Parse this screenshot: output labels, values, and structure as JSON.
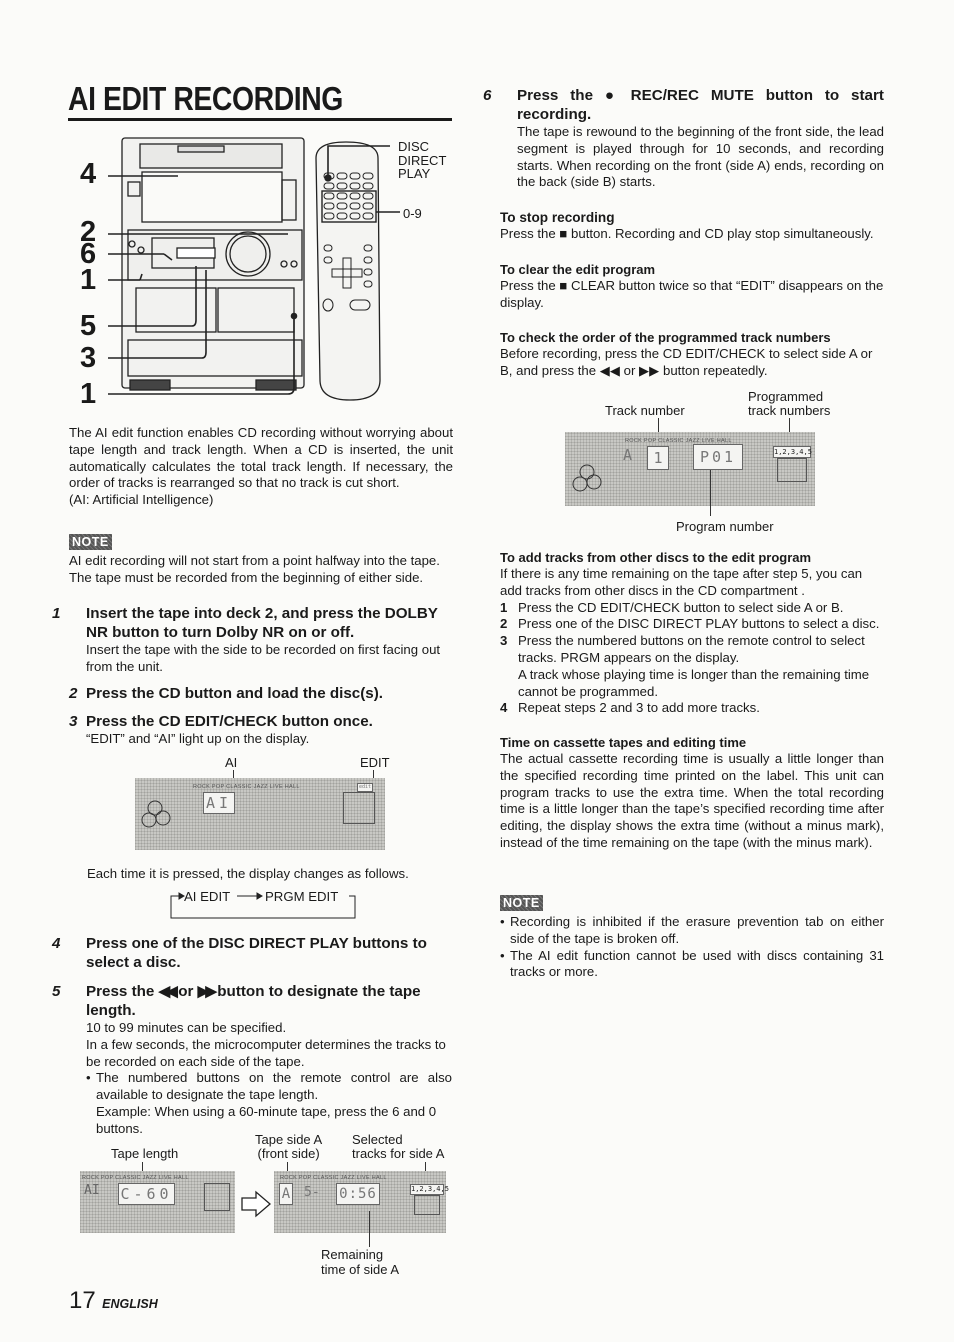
{
  "page": {
    "title": "AI EDIT RECORDING",
    "page_number": "17",
    "language": "ENGLISH"
  },
  "illustration": {
    "callouts_left": [
      "4",
      "2",
      "6",
      "1",
      "5",
      "3",
      "1"
    ],
    "remote_labels": {
      "disc_direct_play": [
        "DISC",
        "DIRECT",
        "PLAY"
      ],
      "number_keys": "0-9"
    }
  },
  "intro": {
    "text": "The AI edit function enables CD recording without worrying about tape length and track length.  When a CD is inserted, the unit automatically calculates the total track length.  If necessary, the order of tracks is rearranged so that no track is cut short.",
    "abbr": "(AI: Artificial Intelligence)"
  },
  "note1": {
    "badge": "NOTE",
    "lines": [
      "AI edit recording will not start from a point halfway into the tape.",
      "The tape must be recorded from the beginning of either side."
    ]
  },
  "steps": [
    {
      "num": "1",
      "heading": "Insert the tape into deck 2, and press the DOLBY NR button to turn Dolby NR on or off.",
      "body": "Insert the tape with the side to be recorded on first facing out from the unit."
    },
    {
      "num": "2",
      "heading": "Press the CD button and load the disc(s).",
      "body": ""
    },
    {
      "num": "3",
      "heading": "Press the CD EDIT/CHECK button once.",
      "body": "“EDIT” and “AI” light up on the display."
    },
    {
      "num": "4",
      "heading": "Press one of the DISC DIRECT PLAY buttons to select a disc.",
      "body": ""
    },
    {
      "num": "5",
      "heading_pre": "Press the",
      "heading_rew": "◀◀",
      "heading_or": "or",
      "heading_ff": "▶▶",
      "heading_post": "button to designate the tape length.",
      "body_lines": [
        "10 to 99 minutes can be specified.",
        "In a few seconds, the microcomputer determines the tracks to be recorded on each side of the tape."
      ],
      "bullet": "The numbered buttons on the remote control are also available to designate the tape length.",
      "example": "Example:  When using a 60-minute tape, press the 6 and 0 buttons."
    },
    {
      "num": "6",
      "heading_pre": "Press the",
      "heading_icon": "●",
      "heading_post": "REC/REC MUTE button to start recording.",
      "body": "The tape is rewound to the beginning of the front side, the lead segment is played through for 10 seconds, and recording starts.  When recording on the front (side A) ends, recording on the back (side B) starts."
    }
  ],
  "display_ai": {
    "label_ai": "AI",
    "label_edit": "EDIT",
    "lcd_main": "AI",
    "lcd_indicators": "ROCK  POP  CLASSIC  JAZZ  LIVE  HALL",
    "lcd_edit_tag": "edit",
    "cycle_intro": "Each time it is pressed, the display changes as follows.",
    "cycle": [
      "AI EDIT",
      "PRGM EDIT"
    ]
  },
  "display_tape": {
    "label_tape_length": "Tape length",
    "label_side_a": [
      "Tape side A",
      "(front side)"
    ],
    "label_selected": [
      "Selected",
      "tracks for side A"
    ],
    "label_remaining": [
      "Remaining",
      "time of side A"
    ],
    "lcd1_ai": "AI",
    "lcd1_main": "C-60",
    "lcd2_side": "A",
    "lcd2_mid": "5-",
    "lcd2_main": "0:56",
    "lcd2_tracks": "1,2,3,4,5"
  },
  "stop": {
    "heading": "To stop recording",
    "text_pre": "Press the",
    "icon": "■",
    "text_post": "button. Recording and CD play stop simultaneously."
  },
  "clear": {
    "heading": "To clear the edit program",
    "text_pre": "Press the",
    "icon": "■",
    "text_post": "CLEAR button twice so that “EDIT” disappears on the display."
  },
  "check": {
    "heading": "To check the order of the programmed track numbers",
    "text": "Before recording, press the CD EDIT/CHECK to select side A or B, and press the ◀◀ or ▶▶ button repeatedly.",
    "label_track": "Track number",
    "label_programmed": [
      "Programmed",
      "track numbers"
    ],
    "label_program": "Program number",
    "lcd_side": "A",
    "lcd_track": "1",
    "lcd_program": "P01",
    "lcd_tracks": "1,2,3,4,5"
  },
  "add": {
    "heading": "To add tracks from other discs to the edit program",
    "intro": "If there is any time remaining on the tape after step 5, you can add tracks from other discs in the CD compartment .",
    "items": [
      {
        "n": "1",
        "text": "Press the CD EDIT/CHECK button to select side A or B."
      },
      {
        "n": "2",
        "text": "Press one of the DISC DIRECT PLAY buttons to select a disc."
      },
      {
        "n": "3",
        "text": "Press the numbered buttons on the remote control to select tracks.  PRGM  appears on the display.",
        "extra": "A track whose playing time is longer than the remaining time cannot be programmed."
      },
      {
        "n": "4",
        "text": "Repeat steps 2 and 3 to add more tracks."
      }
    ]
  },
  "cassette": {
    "heading": "Time on cassette tapes and editing time",
    "text": "The actual cassette recording time is usually a little longer than the specified recording time printed on the label.  This unit can program tracks to use the extra time.  When the total recording time is a little longer than the tape’s specified recording time after editing, the display shows the extra time (without a minus mark), instead of the time remaining on the tape (with the minus mark)."
  },
  "note2": {
    "badge": "NOTE",
    "bullets": [
      "Recording is inhibited if the erasure prevention tab on either side of the tape is broken off.",
      "The AI edit function cannot be used with discs containing 31 tracks or more."
    ]
  }
}
